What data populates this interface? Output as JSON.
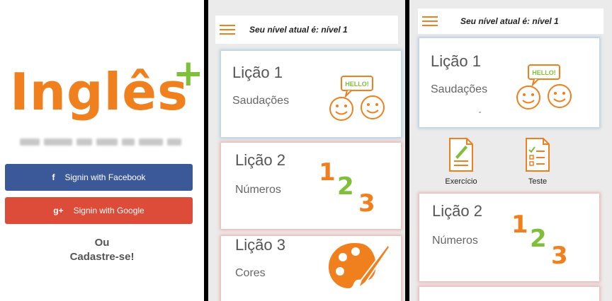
{
  "login": {
    "logo_word": "Inglês",
    "logo_plus": "+",
    "facebook": {
      "icon": "f",
      "label": "Signin with Facebook",
      "color": "#3b5998"
    },
    "google": {
      "icon": "g+",
      "label": "Signin with Google",
      "color": "#dd4b39"
    },
    "or_line1": "Ou",
    "or_line2": "Cadastre-se!"
  },
  "lessons_header": {
    "title": "Seu nível atual é: nível 1"
  },
  "lessons": [
    {
      "title": "Lição 1",
      "subtitle": "Saudações",
      "icon": "smileys-hello-icon",
      "bubble": "HELLO!"
    },
    {
      "title": "Lição 2",
      "subtitle": "Números",
      "icon": "numbers-123-icon",
      "digits": [
        "1",
        "2",
        "3"
      ]
    },
    {
      "title": "Lição 3",
      "subtitle": "Cores",
      "icon": "palette-icon"
    }
  ],
  "detail_header": {
    "title": "Seu nível atual é: nível 1"
  },
  "detail_actions": [
    {
      "label": "Exercício",
      "icon": "exercise-document-icon"
    },
    {
      "label": "Teste",
      "icon": "test-checklist-icon"
    }
  ],
  "colors": {
    "orange": "#f07f1e",
    "green": "#7fbf3a"
  }
}
